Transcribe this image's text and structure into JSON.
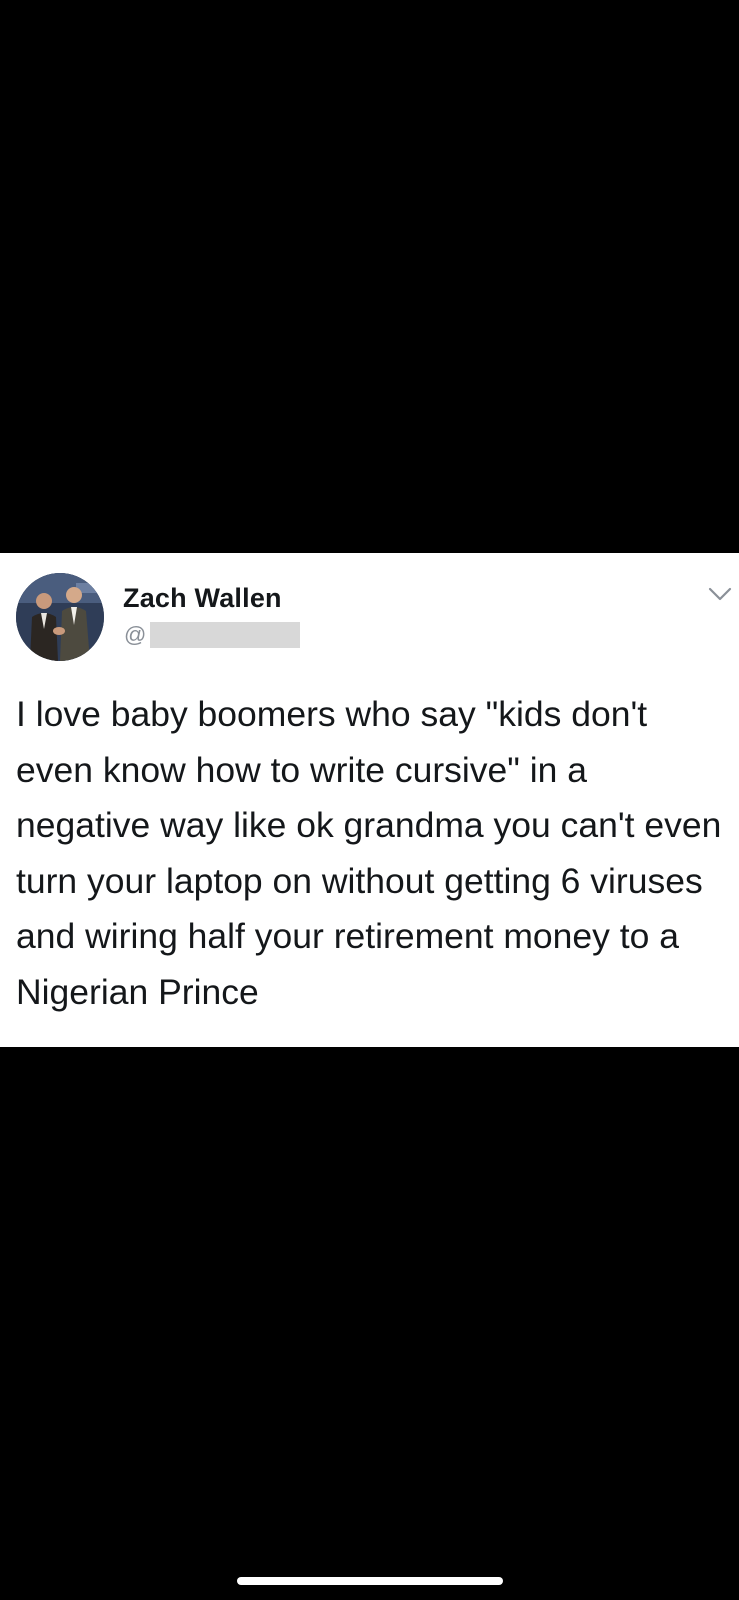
{
  "tweet": {
    "display_name": "Zach Wallen",
    "handle_prefix": "@",
    "text": "I love baby boomers who say \"kids don't even know how to write cursive\" in a negative way like ok grandma you can't even turn your laptop on without getting 6 viruses and wiring half your retirement money to a Nigerian Prince",
    "menu_icon": "chevron-down-icon",
    "avatar_icon": "avatar-photo"
  },
  "colors": {
    "background": "#000000",
    "card": "#ffffff",
    "text": "#14171a",
    "secondary_text": "#8a9098",
    "redaction": "#d8d8d8"
  }
}
